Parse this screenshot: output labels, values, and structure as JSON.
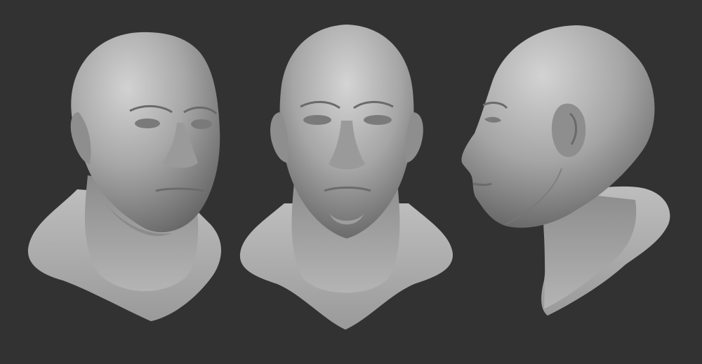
{
  "scene": {
    "background_color": "#323232",
    "clay_color": "#a9a9a9",
    "views": [
      {
        "name": "three-quarter-view"
      },
      {
        "name": "front-view"
      },
      {
        "name": "side-view"
      }
    ]
  }
}
